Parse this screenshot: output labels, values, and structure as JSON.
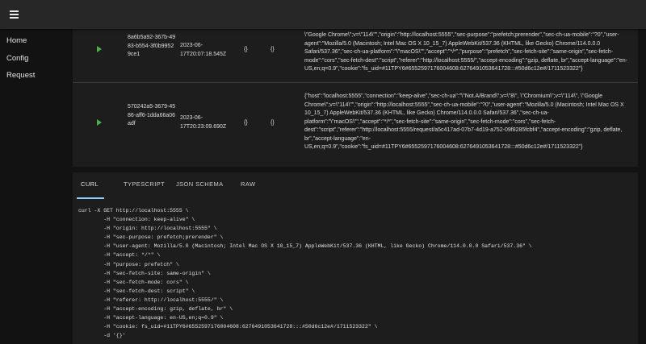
{
  "sidebar": {
    "items": [
      {
        "label": "Home"
      },
      {
        "label": "Config"
      },
      {
        "label": "Request"
      }
    ]
  },
  "table": {
    "rows": [
      {
        "id": "8a6b5a92-367b-4983-b554-3f0b99529ce1",
        "date": "2023-06-17T20:07:18.545Z",
        "col_a": "{}",
        "col_b": "{}",
        "headers": "\\\"Google Chrome\\\";v=\\\"114\\\"\",\"origin\":\"http://localhost:5555\",\"sec-purpose\":\"prefetch;prerender\",\"sec-ch-ua-mobile\":\"?0\",\"user-agent\":\"Mozilla/5.0 (Macintosh; Intel Mac OS X 10_15_7) AppleWebKit/537.36 (KHTML, like Gecko) Chrome/114.0.0.0 Safari/537.36\",\"sec-ch-ua-platform\":\"\\\"macOS\\\"\",\"accept\":\"*/*\",\"purpose\":\"prefetch\",\"sec-fetch-site\":\"same-origin\",\"sec-fetch-mode\":\"cors\",\"sec-fetch-dest\":\"script\",\"referer\":\"http://localhost:5555/\",\"accept-encoding\":\"gzip, deflate, br\",\"accept-language\":\"en-US,en;q=0.9\",\"cookie\":\"fs_uid=#11TPY6#6552597176004608:6276491053641728:::#50d6c12e#/1711523322\"}"
      },
      {
        "id": "570242a5-3679-4586-aff6-1dda66a06adf",
        "date": "2023-06-17T20:23:09.690Z",
        "col_a": "{}",
        "col_b": "{}",
        "headers": "{\"host\":\"localhost:5555\",\"connection\":\"keep-alive\",\"sec-ch-ua\":\"\\\"Not.A/Brand\\\";v=\\\"8\\\", \\\"Chromium\\\";v=\\\"114\\\", \\\"Google Chrome\\\";v=\\\"114\\\"\",\"origin\":\"http://localhost:5555\",\"sec-ch-ua-mobile\":\"?0\",\"user-agent\":\"Mozilla/5.0 (Macintosh; Intel Mac OS X 10_15_7) AppleWebKit/537.36 (KHTML, like Gecko) Chrome/114.0.0.0 Safari/537.36\",\"sec-ch-ua-platform\":\"\\\"macOS\\\"\",\"accept\":\"*/*\",\"sec-fetch-site\":\"same-origin\",\"sec-fetch-mode\":\"cors\",\"sec-fetch-dest\":\"script\",\"referer\":\"http://localhost:5555/request/a5c417ad-07b7-4d19-a752-09f8285fcbf4\",\"accept-encoding\":\"gzip, deflate, br\",\"accept-language\":\"en-US,en;q=0.9\",\"cookie\":\"fs_uid=#11TPY6#6552597176004608:6276491053641728:::#50d6c12e#/1711523322\"}"
      }
    ]
  },
  "code_panel": {
    "tabs": [
      {
        "label": "CURL"
      },
      {
        "label": "TYPESCRIPT"
      },
      {
        "label": "JSON SCHEMA"
      },
      {
        "label": "RAW"
      }
    ],
    "active_tab": "CURL",
    "code": "curl -X GET http://localhost:5555 \\\n        -H \"connection: keep-alive\" \\\n        -H \"origin: http://localhost:5555\" \\\n        -H \"sec-purpose: prefetch;prerender\" \\\n        -H \"user-agent: Mozilla/5.0 (Macintosh; Intel Mac OS X 10_15_7) AppleWebKit/537.36 (KHTML, like Gecko) Chrome/114.0.0.0 Safari/537.36\" \\\n        -H \"accept: */*\" \\\n        -H \"purpose: prefetch\" \\\n        -H \"sec-fetch-site: same-origin\" \\\n        -H \"sec-fetch-mode: cors\" \\\n        -H \"sec-fetch-dest: script\" \\\n        -H \"referer: http://localhost:5555/\" \\\n        -H \"accept-encoding: gzip, deflate, br\" \\\n        -H \"accept-language: en-US,en;q=0.9\" \\\n        -H \"cookie: fs_uid=#11TPY6#6552597176004608:6276491053641728:::#50d6c12e#/1711523322\" \\\n        -d '{}'"
  },
  "colors": {
    "background": "#121212",
    "topbar": "#272727",
    "card": "#1d1d1d",
    "accent": "#90caf9",
    "play": "#4caf50"
  }
}
